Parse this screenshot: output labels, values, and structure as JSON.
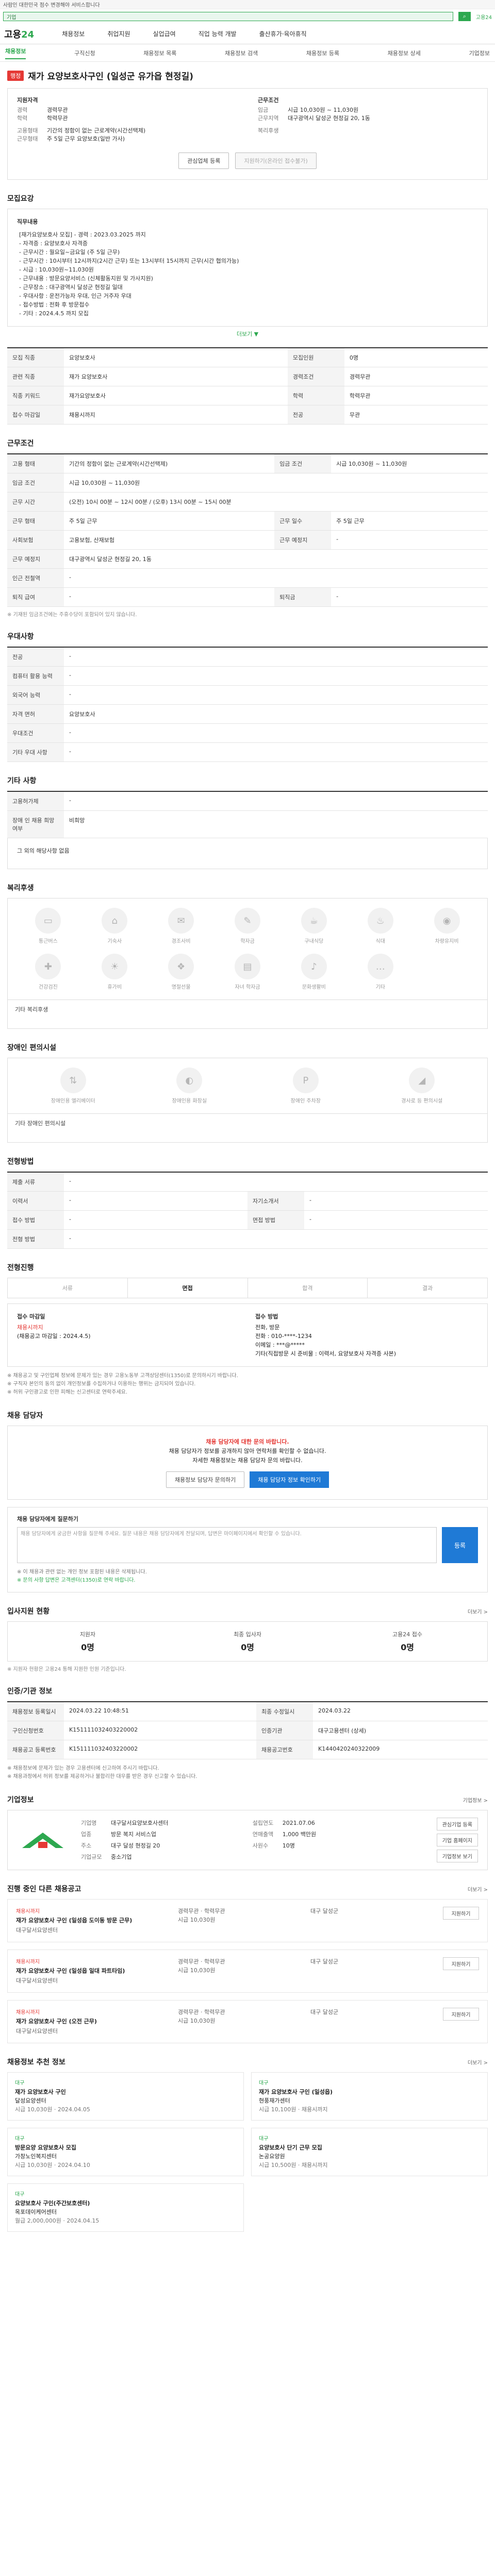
{
  "top": {
    "notice": "사람인 대한민국 점수 변경해야 서비스합니다",
    "search_value": "기업",
    "side_link": "고용24"
  },
  "gnb": {
    "logo_a": "고용",
    "logo_b": "24",
    "items": [
      "채용정보",
      "취업지원",
      "실업급여",
      "직업 능력 개발",
      "출산휴가·육아휴직"
    ]
  },
  "lnb": {
    "items": [
      "채용정보",
      "구직신청",
      "채용정보 목록",
      "채용정보 검색",
      "채용정보 등록",
      "채용정보 상세",
      "기업정보"
    ]
  },
  "job": {
    "badge": "행정",
    "title": "재가 요양보호사구인 (일성군 유가읍 현정길)",
    "summary": {
      "left_head": "지원자격",
      "right_head": "근무조건",
      "rows_left": [
        {
          "k": "경력",
          "v": "경력무관"
        },
        {
          "k": "학력",
          "v": "학력무관"
        },
        {
          "k": "고용형태",
          "v": "기간의 정함이 없는 근로계약(시간선택제)"
        },
        {
          "k": "근무형태",
          "v": "주 5일 근무 요양보호(일반 가사)"
        }
      ],
      "rows_right": [
        {
          "k": "임금",
          "v": "시급 10,030원 ~ 11,030원"
        },
        {
          "k": "근무지역",
          "v": "대구광역시 달성군 현정길 20, 1동"
        },
        {
          "k": "복리후생",
          "v": ""
        }
      ],
      "btn_apply": "관심업체 등록",
      "btn_disabled": "지원하기(온라인 접수불가)"
    },
    "detail_title": "모집요강",
    "detail_head": "직무내용",
    "detail_lines": [
      "[재가요양보호사 모집] - 경력 : 2023.03.2025 까지",
      "- 자격증 : 요양보호사 자격증",
      "- 근무시간 : 월요일~금요일 (주 5일 근무)",
      "- 근무시간 : 10시부터 12시까지(2시간 근무) 또는 13시부터 15시까지 근무(시간 협의가능)",
      "- 시급 : 10,030원~11,030원",
      "- 근무내용 : 방문요양서비스 (신체활동지원 및 가사지원)",
      "- 근무장소 : 대구광역시 달성군 현정길 일대",
      "- 우대사항 : 운전가능자 우대, 인근 거주자 우대",
      "- 접수방법 : 전화 후 방문접수",
      "- 기타 : 2024.4.5 까지 모집"
    ],
    "more_label": "더보기 ▼",
    "recruit_table": [
      {
        "k": "모집 직종",
        "v": "요양보호사"
      },
      {
        "k": "관련 직종",
        "v": "재가 요양보호사"
      },
      {
        "k": "직종 키워드",
        "v": "재가요양보호사"
      },
      {
        "k": "접수 마감일",
        "v": "채용시까지"
      }
    ],
    "recruit_right": [
      {
        "k": "모집인원",
        "v": "0명"
      },
      {
        "k": "경력조건",
        "v": "경력무관"
      },
      {
        "k": "학력",
        "v": "학력무관"
      },
      {
        "k": "전공",
        "v": "무관"
      }
    ],
    "conditions_title": "근무조건",
    "conditions": [
      {
        "k": "고용 형태",
        "v": "기간의 정함이 없는 근로계약(시간선택제)"
      },
      {
        "k": "임금 조건",
        "v": "시급 10,030원 ~ 11,030원"
      },
      {
        "k": "근무 시간",
        "v": "(오전) 10시 00분 ~ 12시 00분 / (오후) 13시 00분 ~ 15시 00분"
      },
      {
        "k": "근무 형태",
        "v": "주 5일 근무"
      },
      {
        "k": "사회보험",
        "v": "고용보험, 산재보험"
      },
      {
        "k": "근무 예정지",
        "v": "대구광역시 달성군 현정길 20, 1동"
      },
      {
        "k": "인근 전철역",
        "v": "-"
      },
      {
        "k": "퇴직 급여",
        "v": "-"
      }
    ],
    "conditions_right": [
      {
        "k": "임금 조건",
        "v": "시급 10,030원 ~ 11,030원"
      },
      {
        "k": "근무 예정지",
        "v": "-"
      },
      {
        "k": "근무 일수",
        "v": "주 5일 근무"
      },
      {
        "k": "퇴직금",
        "v": "-"
      }
    ],
    "conditions_note": "※ 기재된 임금조건에는 주휴수당이 포함되어 있지 않습니다.",
    "eligibility_title": "우대사항",
    "eligibility": [
      {
        "k": "전공",
        "v": "-"
      },
      {
        "k": "컴퓨터 활용 능력",
        "v": "-"
      },
      {
        "k": "외국어 능력",
        "v": "-"
      },
      {
        "k": "자격 면허",
        "v": "요양보호사"
      },
      {
        "k": "우대조건",
        "v": "-"
      },
      {
        "k": "기타 우대 사항",
        "v": "-"
      }
    ],
    "etc_title": "기타 사항",
    "etc": [
      {
        "k": "고용허가제",
        "v": "-"
      },
      {
        "k": "장애 인 채용 희망 여부",
        "v": "비희망"
      }
    ],
    "etc_text": "그 외의 해당사항 없음",
    "welfare_title": "복리후생",
    "welfare_icons": [
      "통근버스",
      "기숙사",
      "경조사비",
      "학자금",
      "구내식당",
      "식대",
      "차량유지비",
      "건강검진",
      "휴가비",
      "명절선물",
      "자녀 학자금",
      "문화생활비",
      "기타",
      ""
    ],
    "welfare_text": "기타 복리후생",
    "disability_title": "장애인 편의시설",
    "disability_icons": [
      "장애인용 엘리베이터",
      "장애인용 화장실",
      "장애인 주차장",
      "경사로 등 편의시설"
    ],
    "disability_text": "기타 장애인 편의시설",
    "process_title": "전형방법",
    "process": [
      {
        "k": "제출 서류",
        "v": "-"
      },
      {
        "k": "이력서",
        "v": "-"
      },
      {
        "k": "접수 방법",
        "v": "-"
      }
    ],
    "process_right": [
      {
        "k": "자기소개서",
        "v": "-"
      },
      {
        "k": "면접 방법",
        "v": "-"
      },
      {
        "k": "전형 방법",
        "v": "-"
      }
    ],
    "apply_title": "전형진행",
    "steps": [
      "서류",
      "면접",
      "합격",
      "결과"
    ],
    "apply_left_head": "접수 마감일",
    "apply_left_1": "채용시까지",
    "apply_left_2": "(채용공고 마감일 : 2024.4.5)",
    "apply_right_head": "접수 방법",
    "apply_right_1": "전화, 방문",
    "apply_right_2": "전화 : 010-****-1234",
    "apply_right_3": "이메일 : ***@*****",
    "apply_right_4": "기타(직접방문 시 준비물 : 이력서, 요양보호사 자격증 사본)",
    "apply_bullets": [
      "※ 채용공고 및 구인업체 정보에 문제가 있는 경우 고용노동부 고객상담센터(1350)로 문의하시기 바랍니다.",
      "※ 구직자 본인의 동의 없이 개인정보를 수집하거나 이용하는 행위는 금지되어 있습니다.",
      "※ 허위 구인광고로 인한 피해는 신고센터로 연락주세요."
    ],
    "contact_title": "채용 담당자",
    "contact_lines": [
      "채용 담당자에 대한 문의 바랍니다.",
      "채용 담당자가 정보를 공개하지 않아 연락처를 확인할 수 없습니다.",
      "자세한 채용정보는 채용 담당자 문의 바랍니다."
    ],
    "contact_btn1": "채용정보 담당자 문의하기",
    "contact_btn2": "채용 담당자 정보 확인하기",
    "qna_title": "채용 담당자에게 질문하기",
    "qna_placeholder": "채용 담당자에게 궁금한 사항을 질문해 주세요. 질문 내용은 채용 담당자에게 전달되며, 답변은 마이페이지에서 확인할 수 있습니다.",
    "qna_btn": "등록",
    "qna_notes": [
      "※ 이 채용과 관련 없는 개인 정보 포함된 내용은 삭제됩니다.",
      "※ 문의 사항 답변은 고객센터(1350)로 연락 바랍니다."
    ],
    "stats_title": "입사지원 현황",
    "stats_more": "더보기 >",
    "stats": [
      {
        "label": "지원자",
        "value": "0명"
      },
      {
        "label": "최종 입사자",
        "value": "0명"
      },
      {
        "label": "고용24 접수",
        "value": "0명"
      }
    ],
    "stats_note": "※ 지원자 현황은 고용24 통해 지원한 인원 기준입니다.",
    "info_title": "인증/기관 정보",
    "info_rows": [
      {
        "k": "채용정보 등록일시",
        "v": "2024.03.22 10:48:51"
      },
      {
        "k": "구인신청번호",
        "v": "K151111032403220002"
      },
      {
        "k": "채용공고 등록번호",
        "v": "K151111032403220002"
      }
    ],
    "info_right": [
      {
        "k": "최종 수정일시",
        "v": "2024.03.22"
      },
      {
        "k": "인증기관",
        "v": "대구고용센터 (상세)"
      },
      {
        "k": "채용공고번호",
        "v": "K1440420240322009"
      }
    ],
    "info_bullets": [
      "※ 채용정보에 문제가 있는 경우 고용센터에 신고하여 주시기 바랍니다.",
      "※ 채용과정에서 허위 정보를 제공하거나 불합리한 대우를 받은 경우 신고할 수 있습니다."
    ],
    "company_title": "기업정보",
    "company_more": "기업정보 >",
    "company_rows": [
      {
        "k": "기업명",
        "v": "대구달서요양보호사센터"
      },
      {
        "k": "업종",
        "v": "방문 복지 서비스업"
      },
      {
        "k": "주소",
        "v": "대구 달성 현정길 20"
      },
      {
        "k": "기업규모",
        "v": "중소기업"
      }
    ],
    "company_right": [
      {
        "k": "설립연도",
        "v": "2021.07.06"
      },
      {
        "k": "연매출액",
        "v": "1,000 백만원"
      },
      {
        "k": "사원수",
        "v": "10명"
      }
    ],
    "company_btns": [
      "관심기업 등록",
      "기업 홈페이지",
      "기업정보 보기"
    ],
    "related_title": "진행 중인 다른 채용공고",
    "related_more": "더보기 >",
    "related": [
      {
        "tag": "채용시까지",
        "title": "재가 요양보호사 구인 (일성읍 도이동 방문 근무)",
        "co": "대구달서요양센터",
        "m1": "경력무관 · 학력무관",
        "m2": "시급 10,030원",
        "m3": "대구 달성군",
        "btn": "지원하기"
      },
      {
        "tag": "채용시까지",
        "title": "재가 요양보호사 구인 (일성읍 일대 파트타임)",
        "co": "대구달서요양센터",
        "m1": "경력무관 · 학력무관",
        "m2": "시급 10,030원",
        "m3": "대구 달성군",
        "btn": "지원하기"
      },
      {
        "tag": "채용시까지",
        "title": "재가 요양보호사 구인 (오전 근무)",
        "co": "대구달서요양센터",
        "m1": "경력무관 · 학력무관",
        "m2": "시급 10,030원",
        "m3": "대구 달성군",
        "btn": "지원하기"
      }
    ],
    "rec_title": "채용정보 추천 정보",
    "rec_more": "더보기 >",
    "rec_cards": [
      {
        "tag": "대구",
        "title": "재가 요양보호사 구인",
        "co": "달성요양센터",
        "m": "시급 10,030원 · 2024.04.05"
      },
      {
        "tag": "대구",
        "title": "재가 요양보호사 구인 (일성읍)",
        "co": "현풍재가센터",
        "m": "시급 10,100원 · 채용시까지"
      },
      {
        "tag": "대구",
        "title": "방문요양 요양보호사 모집",
        "co": "가창노인복지센터",
        "m": "시급 10,030원 · 2024.04.10"
      },
      {
        "tag": "대구",
        "title": "요양보호사 단기 근무 모집",
        "co": "논공요양원",
        "m": "시급 10,500원 · 채용시까지"
      },
      {
        "tag": "대구",
        "title": "요양보호사 구인(주간보호센터)",
        "co": "옥포데이케어센터",
        "m": "월급 2,000,000원 · 2024.04.15"
      }
    ]
  }
}
